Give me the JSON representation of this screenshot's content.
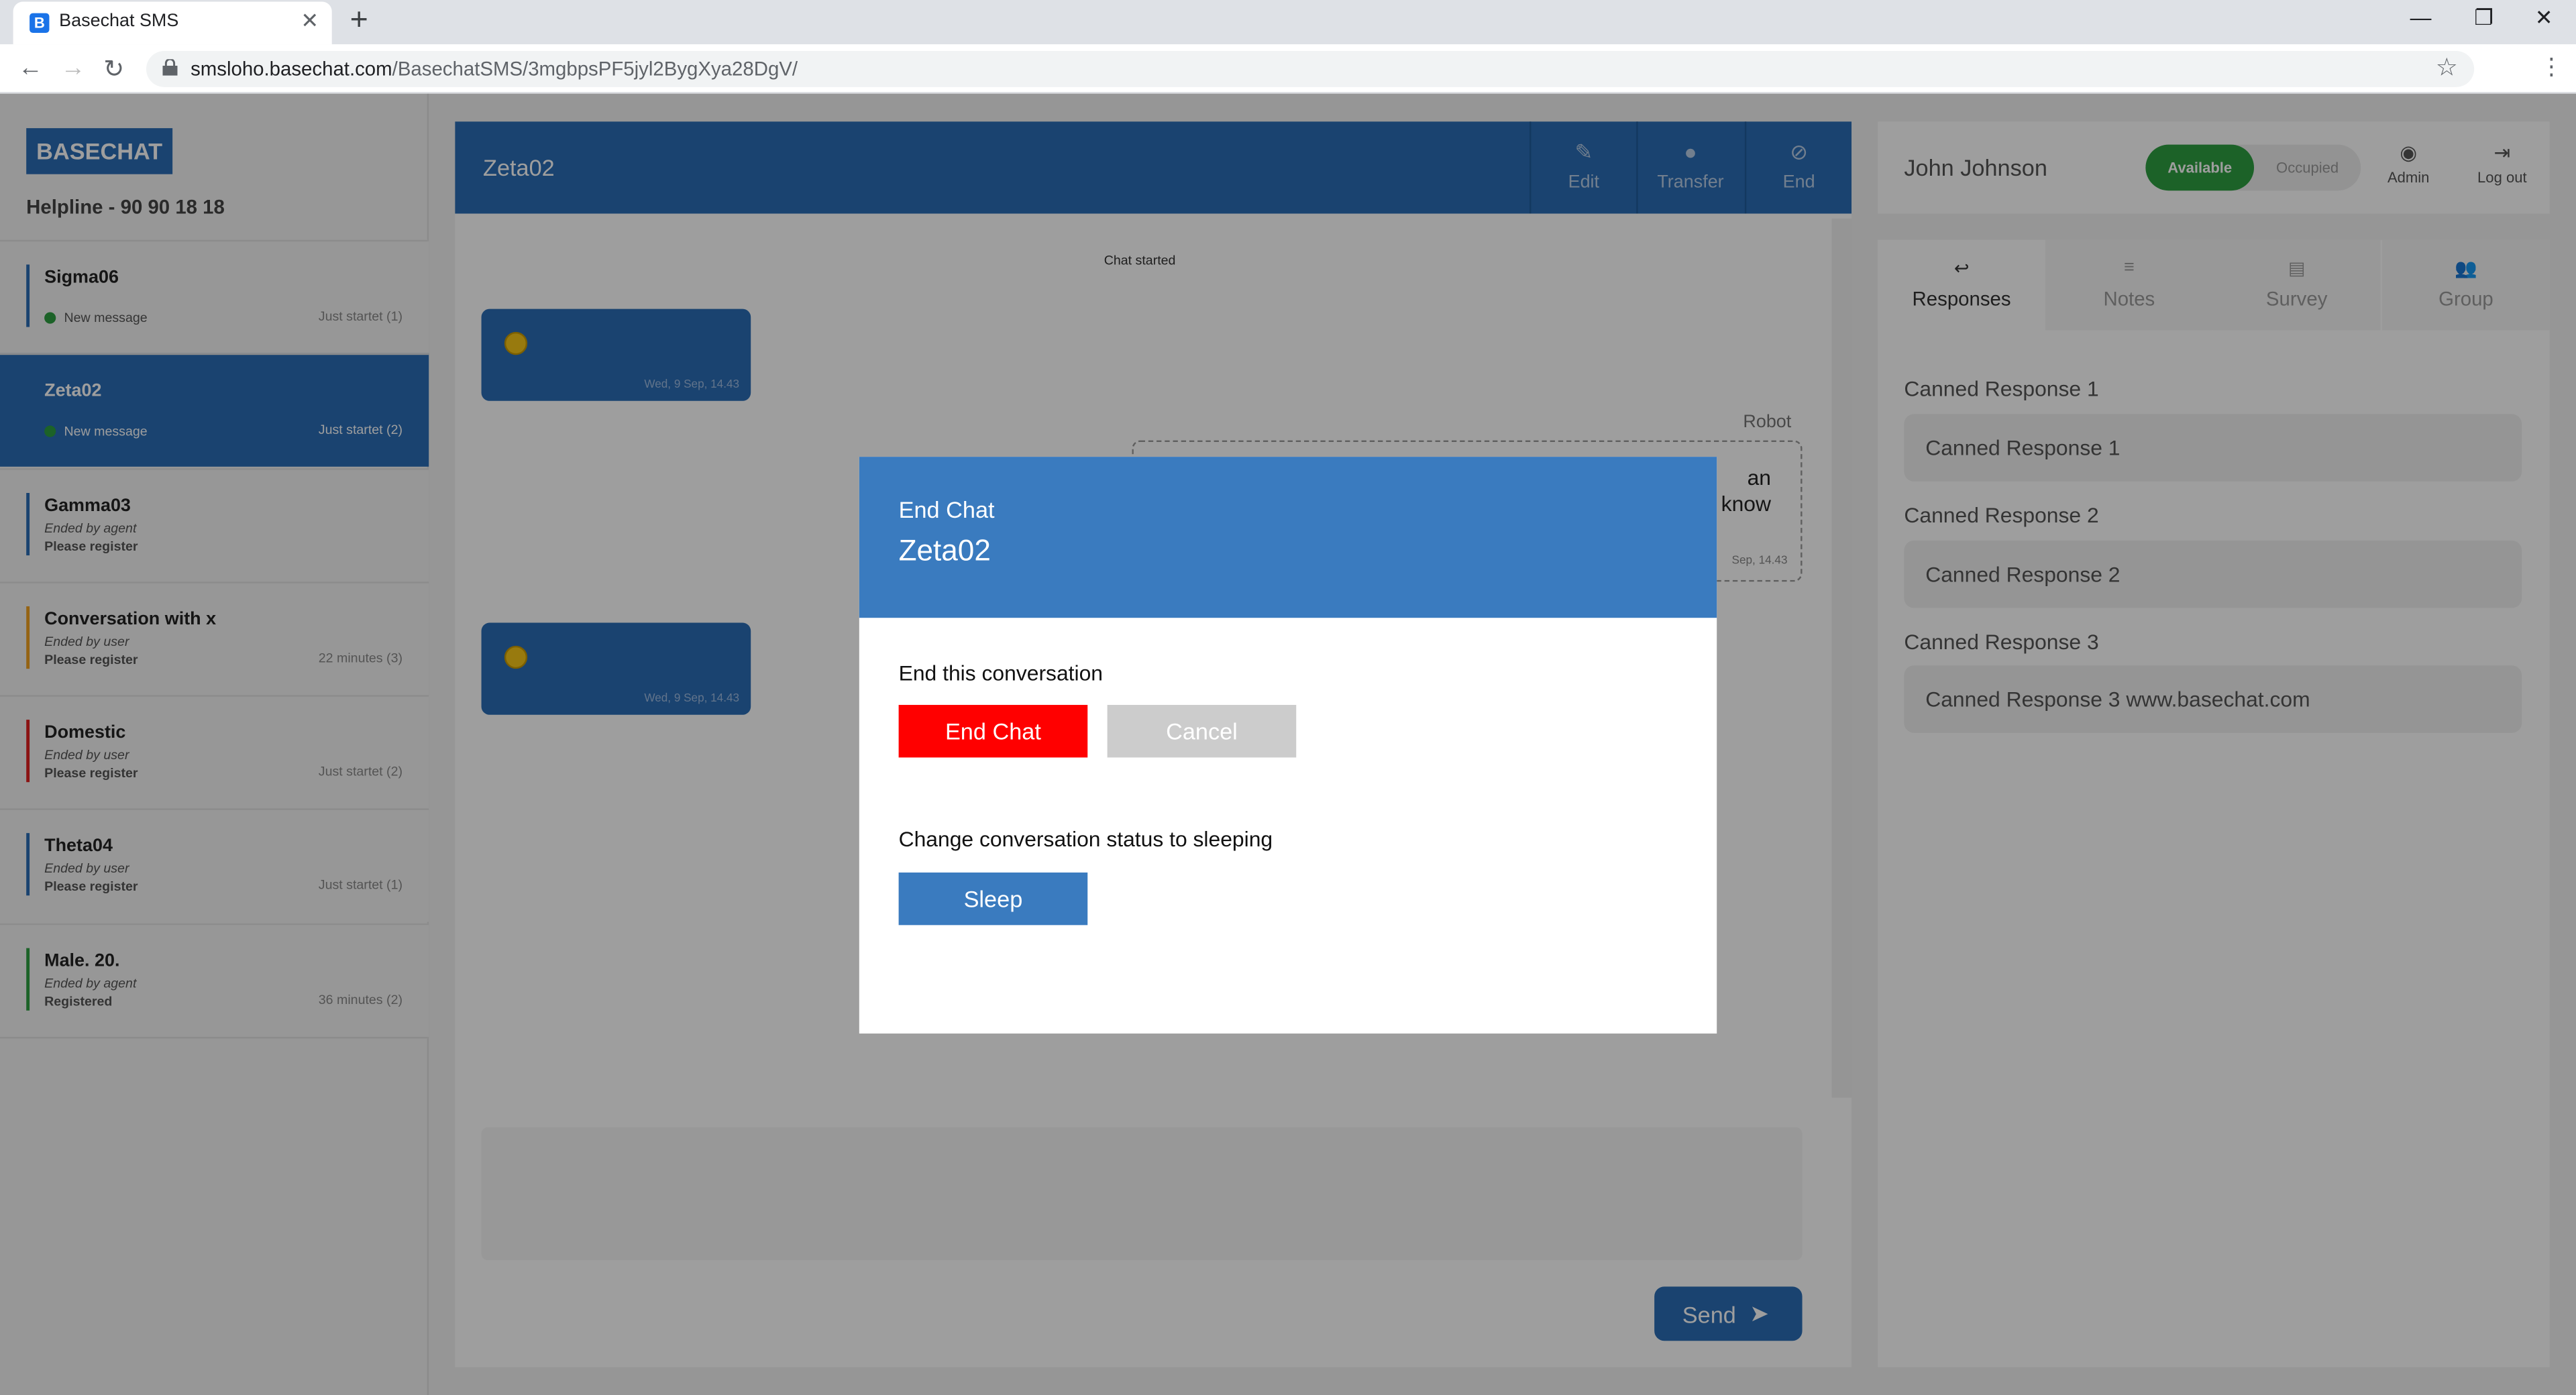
{
  "browser": {
    "tab_title": "Basechat SMS",
    "tab_favicon_letter": "B",
    "new_tab": "+",
    "url_host": "smsloho.basechat.com",
    "url_path": "/BasechatSMS/3mgbpsPF5jyl2BygXya28DgV/",
    "icons": [
      "back-icon",
      "forward-icon",
      "reload-icon",
      "lock-icon",
      "star-icon",
      "menu-icon",
      "minimize-icon",
      "restore-icon",
      "close-icon"
    ]
  },
  "sidebar": {
    "logo": "BASECHAT",
    "helpline": "Helpline - 90 90 18 18",
    "conversations": [
      {
        "name": "Sigma06",
        "line1": "",
        "line2": "",
        "new_message": "New message",
        "time": "Just startet (1)",
        "color": "#2a6db5",
        "active": false
      },
      {
        "name": "Zeta02",
        "line1": "",
        "line2": "",
        "new_message": "New message",
        "time": "Just startet (2)",
        "color": "#2a6db5",
        "active": true
      },
      {
        "name": "Gamma03",
        "line1": "Ended by agent",
        "line2": "Please register",
        "new_message": "",
        "time": "",
        "color": "#2a6db5",
        "active": false
      },
      {
        "name": "Conversation with x",
        "line1": "Ended by user",
        "line2": "Please register",
        "new_message": "",
        "time": "22 minutes (3)",
        "color": "#f0a020",
        "active": false
      },
      {
        "name": "Domestic",
        "line1": "Ended by user",
        "line2": "Please register",
        "new_message": "",
        "time": "Just startet (2)",
        "color": "#e02020",
        "active": false
      },
      {
        "name": "Theta04",
        "line1": "Ended by user",
        "line2": "Please register",
        "new_message": "",
        "time": "Just startet (1)",
        "color": "#2a6db5",
        "active": false
      },
      {
        "name": "Male. 20.",
        "line1": "Ended by agent",
        "line2": "Registered",
        "new_message": "",
        "time": "36 minutes (2)",
        "color": "#2e9e41",
        "active": false
      }
    ]
  },
  "chat": {
    "title": "Zeta02",
    "header_buttons": [
      {
        "label": "Edit",
        "icon": "pencil-icon"
      },
      {
        "label": "Transfer",
        "icon": "person-icon"
      },
      {
        "label": "End",
        "icon": "block-icon"
      }
    ],
    "chat_started": "Chat started",
    "messages": [
      {
        "emoji": "smiley-emoji",
        "timestamp": "Wed, 9 Sep, 14.43"
      },
      {
        "emoji": "grin-emoji",
        "timestamp": "Wed, 9 Sep, 14.43"
      }
    ],
    "robot_label": "Robot",
    "robot_text_line1": "an",
    "robot_text_line2": "know",
    "robot_timestamp": "Sep, 14.43",
    "send_label": "Send"
  },
  "agent": {
    "name": "John Johnson",
    "status_available": "Available",
    "status_occupied": "Occupied",
    "admin_label": "Admin",
    "logout_label": "Log out"
  },
  "right_panel": {
    "tabs": [
      {
        "label": "Responses",
        "icon": "reply-icon",
        "active": true
      },
      {
        "label": "Notes",
        "icon": "notes-icon",
        "active": false
      },
      {
        "label": "Survey",
        "icon": "survey-icon",
        "active": false
      },
      {
        "label": "Group",
        "icon": "group-icon",
        "active": false
      }
    ],
    "canned": [
      {
        "label": "Canned Response 1",
        "text": "Canned Response 1"
      },
      {
        "label": "Canned Response 2",
        "text": "Canned Response 2"
      },
      {
        "label": "Canned Response 3",
        "text": "Canned Response 3 www.basechat.com"
      }
    ]
  },
  "modal": {
    "title": "End Chat",
    "subtitle": "Zeta02",
    "end_text": "End this conversation",
    "end_button": "End Chat",
    "cancel_button": "Cancel",
    "sleep_text": "Change conversation status to sleeping",
    "sleep_button": "Sleep",
    "colors": {
      "end": "#ff0000",
      "cancel": "#cccccc",
      "sleep": "#3a7bbf",
      "header": "#3a7bbf"
    }
  }
}
